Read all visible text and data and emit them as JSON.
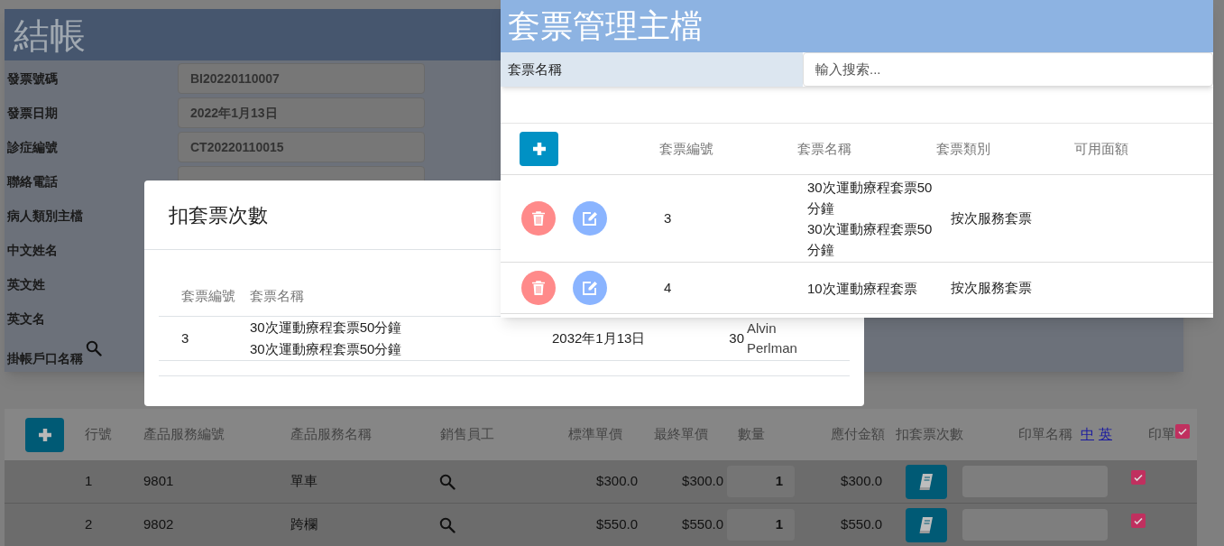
{
  "checkout": {
    "title": "結帳",
    "fields": [
      {
        "kind": "field",
        "label": "發票號碼",
        "value": "BI20220110007"
      },
      {
        "kind": "field",
        "label": "發票日期",
        "value": "2022年1月13日"
      },
      {
        "kind": "field",
        "label": "診症編號",
        "value": "CT20220110015"
      },
      {
        "kind": "field",
        "label": "聯絡電話"
      },
      {
        "kind": "label",
        "label": "病人類別主檔"
      },
      {
        "kind": "label",
        "label": "中文姓名"
      },
      {
        "kind": "label",
        "label": "英文姓"
      },
      {
        "kind": "label",
        "label": "英文名"
      },
      {
        "kind": "search",
        "label": "掛帳戶口名稱"
      }
    ]
  },
  "line_items": {
    "columns": [
      "行號",
      "產品服務編號",
      "產品服務名稱",
      "銷售員工",
      "標準單價",
      "最終單價",
      "數量",
      "應付金額",
      "扣套票次數",
      "印單名稱",
      "印單"
    ],
    "print_links": [
      "中",
      "英"
    ],
    "print_all_checked": true,
    "rows": [
      {
        "line": "1",
        "code": "9801",
        "name": "單車",
        "standard_price": "$300.0",
        "final_price": "$300.0",
        "quantity": "1",
        "amount": "$300.0",
        "print_checked": true
      },
      {
        "line": "2",
        "code": "9802",
        "name": "跨欄",
        "standard_price": "$550.0",
        "final_price": "$550.0",
        "quantity": "1",
        "amount": "$550.0",
        "print_checked": true
      }
    ]
  },
  "deduct_dialog": {
    "title": "扣套票次數",
    "columns": [
      "套票編號",
      "套票名稱"
    ],
    "rows": [
      {
        "id": "3",
        "names": [
          "30次運動療程套票50分鐘",
          "30次運動療程套票50分鐘"
        ],
        "date": "2032年1月13日",
        "count": "30",
        "person": "Alvin Perlman"
      }
    ]
  },
  "package_master": {
    "title": "套票管理主檔",
    "search_label": "套票名稱",
    "search_placeholder": "輸入搜索...",
    "columns": [
      "套票編號",
      "套票名稱",
      "套票類別",
      "可用面額"
    ],
    "rows": [
      {
        "id": "3",
        "names": [
          "30次運動療程套票50分鐘",
          "30次運動療程套票50分鐘"
        ],
        "category": "按次服務套票"
      },
      {
        "id": "4",
        "names": [
          "10次運動療程套票"
        ],
        "category": "按次服務套票"
      }
    ]
  }
}
